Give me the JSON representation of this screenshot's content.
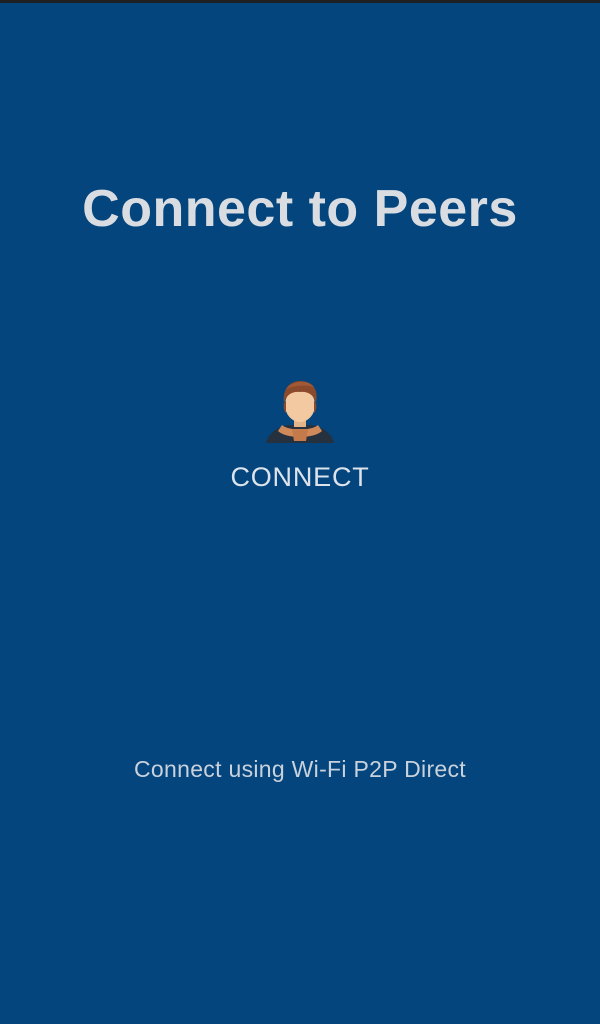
{
  "screen": {
    "title": "Connect to Peers",
    "connect_button": {
      "label": "CONNECT",
      "icon": "person-avatar-icon"
    },
    "footer_caption": "Connect using Wi-Fi P2P Direct"
  },
  "colors": {
    "background": "#04457d",
    "title_text": "#d9dde2",
    "label_text": "#dce3ea",
    "caption_text": "#c9d2dc"
  }
}
